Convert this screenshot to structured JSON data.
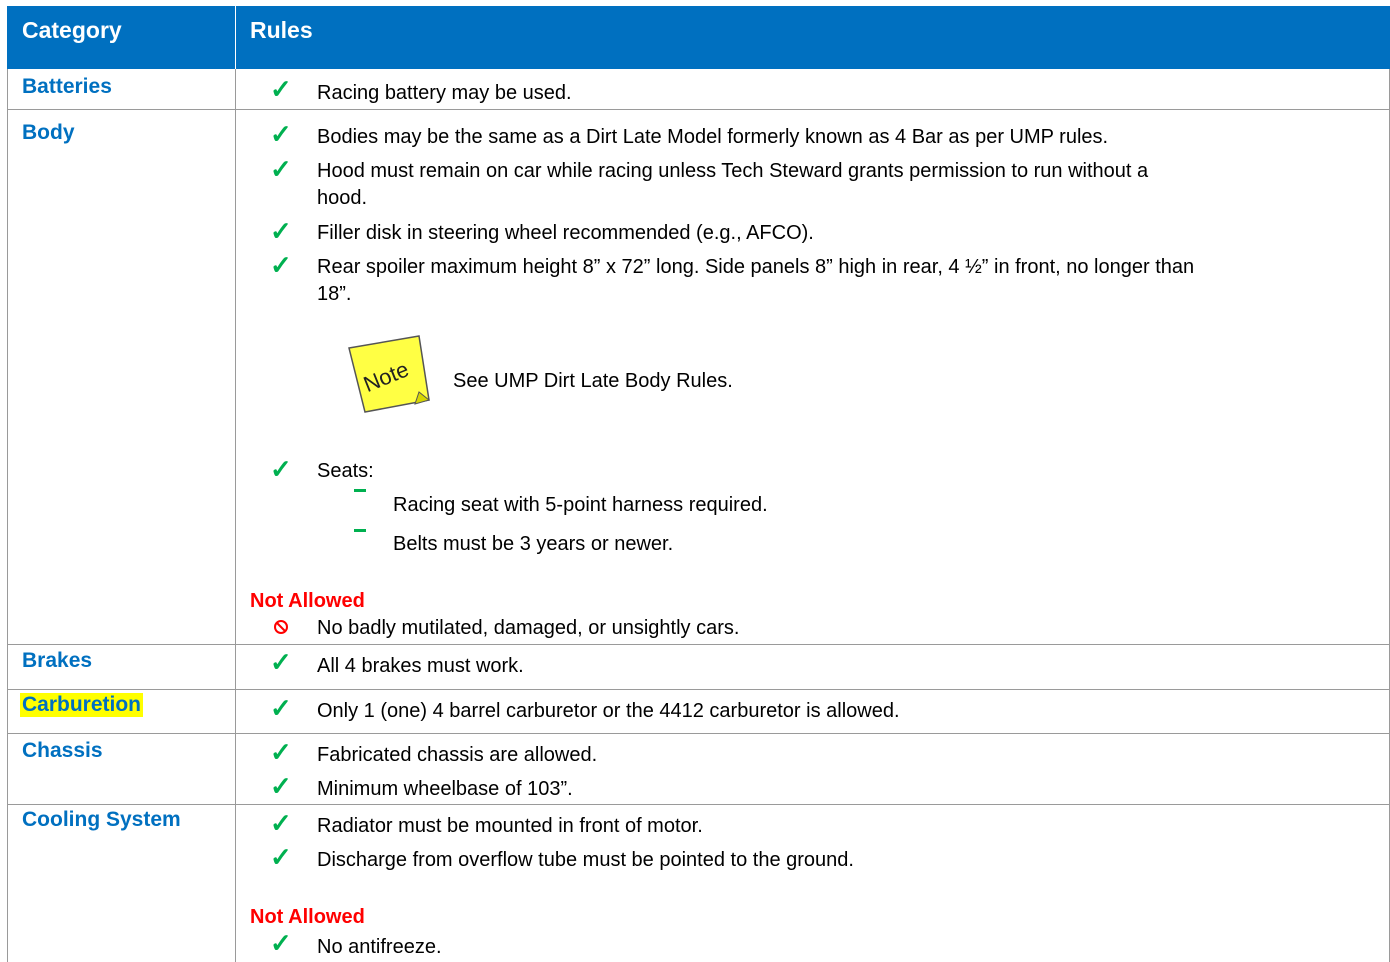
{
  "header": {
    "category_label": "Category",
    "rules_label": "Rules"
  },
  "colors": {
    "header_bg": "#0070c0",
    "category_text": "#0070c0",
    "check": "#00b050",
    "not_allowed": "#ff0000",
    "highlight": "#ffff00",
    "note_bg": "#ffff44"
  },
  "icons": {
    "check": "check-icon",
    "dash": "dash-icon",
    "prohibited": "prohibited-icon",
    "note": "sticky-note-icon"
  },
  "rows": {
    "batteries": {
      "category": "Batteries",
      "rules": [
        "Racing battery may be used."
      ]
    },
    "body": {
      "category": "Body",
      "rules": [
        "Bodies may be the same as a Dirt Late Model formerly known as 4 Bar as per UMP rules.",
        "Hood must remain on car while racing unless Tech Steward grants permission to run without a",
        "hood.",
        "Filler disk in steering wheel recommended (e.g., AFCO).",
        "Rear spoiler maximum height 8” x 72” long. Side panels 8” high in rear, 4 ½” in front, no longer than",
        "18”."
      ],
      "note_label": "Note",
      "note_text": "See UMP Dirt Late Body Rules.",
      "seats_label": "Seats:",
      "seat_items": [
        "Racing seat with 5-point harness required.",
        "Belts must be 3 years or newer."
      ],
      "not_allowed_label": "Not Allowed",
      "not_allowed": [
        "No badly mutilated, damaged, or unsightly cars."
      ]
    },
    "brakes": {
      "category": "Brakes",
      "rules": [
        "All 4 brakes must work."
      ]
    },
    "carburetion": {
      "category": "Carburetion",
      "rules": [
        "Only 1 (one) 4 barrel carburetor or the 4412 carburetor is allowed."
      ]
    },
    "chassis": {
      "category": "Chassis",
      "rules": [
        "Fabricated chassis are allowed.",
        "Minimum wheelbase of 103”."
      ]
    },
    "cooling": {
      "category": "Cooling System",
      "rules": [
        "Radiator must be mounted in front of motor.",
        "Discharge from overflow tube must be pointed to the ground."
      ],
      "not_allowed_label": "Not Allowed",
      "not_allowed": [
        "No antifreeze."
      ]
    }
  }
}
